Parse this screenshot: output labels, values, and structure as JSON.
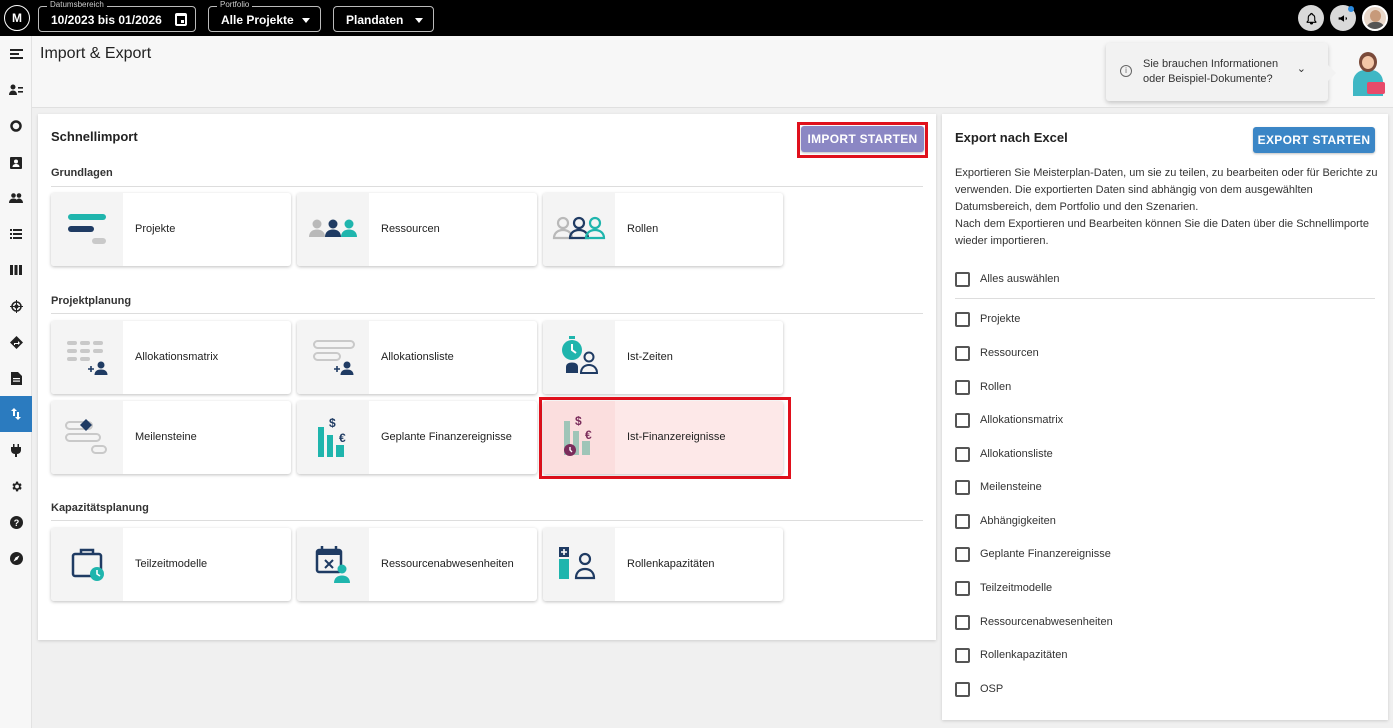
{
  "topbar": {
    "logo_text": "M",
    "date_caption": "Datumsbereich",
    "date_value": "10/2023 bis 01/2026",
    "portfolio_caption": "Portfolio",
    "portfolio_value": "Alle Projekte",
    "data_value": "Plandaten"
  },
  "header": {
    "title": "Import & Export",
    "info_text": "Sie brauchen Informationen oder Beispiel-Dokumente?"
  },
  "import": {
    "title": "Schnellimport",
    "button_label": "IMPORT STARTEN",
    "sections": [
      {
        "title": "Grundlagen",
        "tiles": [
          "Projekte",
          "Ressourcen",
          "Rollen"
        ]
      },
      {
        "title": "Projektplanung",
        "tiles": [
          "Allokationsmatrix",
          "Allokationsliste",
          "Ist-Zeiten",
          "Meilensteine",
          "Geplante Finanzereignisse",
          "Ist-Finanzereignisse"
        ]
      },
      {
        "title": "Kapazitätsplanung",
        "tiles": [
          "Teilzeitmodelle",
          "Ressourcenabwesenheiten",
          "Rollenkapazitäten"
        ]
      }
    ],
    "highlighted_tile": "Ist-Finanzereignisse"
  },
  "export": {
    "title": "Export nach Excel",
    "button_label": "EXPORT STARTEN",
    "description": "Exportieren Sie Meisterplan-Daten, um sie zu teilen, zu bearbeiten oder für Berichte zu verwenden. Die exportierten Daten sind abhängig von dem ausgewählten Datumsbereich, dem Portfolio und den Szenarien.",
    "description2": "Nach dem Exportieren und Bearbeiten können Sie die Daten über die Schnellimporte wieder importieren.",
    "select_all": "Alles auswählen",
    "items": [
      "Projekte",
      "Ressourcen",
      "Rollen",
      "Allokationsmatrix",
      "Allokationsliste",
      "Meilensteine",
      "Abhängigkeiten",
      "Geplante Finanzereignisse",
      "Teilzeitmodelle",
      "Ressourcenabwesenheiten",
      "Rollenkapazitäten",
      "OSP"
    ]
  },
  "colors": {
    "accent": "#2b7bbf",
    "teal": "#1fb5ad",
    "navy": "#1f3b63",
    "highlight": "#e0101c"
  }
}
